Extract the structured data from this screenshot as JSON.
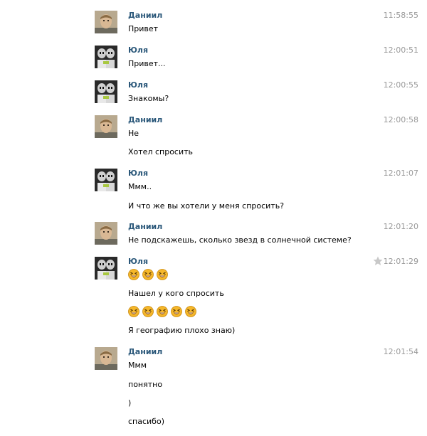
{
  "users": {
    "daniil": "Даниил",
    "yulia": "Юля"
  },
  "messages": [
    {
      "sender": "Даниил",
      "time": "11:58:55",
      "lines": [
        "Привет"
      ]
    },
    {
      "sender": "Юля",
      "time": "12:00:51",
      "lines": [
        "Привет..."
      ]
    },
    {
      "sender": "Юля",
      "time": "12:00:55",
      "lines": [
        "Знакомы?"
      ]
    },
    {
      "sender": "Даниил",
      "time": "12:00:58",
      "lines": [
        "Не",
        "Хотел спросить"
      ]
    },
    {
      "sender": "Юля",
      "time": "12:01:07",
      "lines": [
        "Ммм..",
        "И что же вы хотели у меня спросить?"
      ]
    },
    {
      "sender": "Даниил",
      "time": "12:01:20",
      "lines": [
        "Не подскажешь, сколько звезд в солнечной системе?"
      ]
    },
    {
      "sender": "Юля",
      "time": "12:01:29",
      "emoji_row_1": [
        "laughing-emoji",
        "laughing-emoji",
        "laughing-emoji"
      ],
      "lines": [
        "Нашел у кого спросить",
        "Я географию плохо знаю)"
      ],
      "emoji_row_2": [
        "laughing-emoji",
        "laughing-emoji",
        "laughing-emoji",
        "laughing-emoji",
        "laughing-emoji"
      ],
      "icon": "star-icon"
    },
    {
      "sender": "Даниил",
      "time": "12:01:54",
      "lines": [
        "Ммм",
        "понятно",
        ")",
        "спасибо)"
      ]
    }
  ],
  "colors": {
    "sender_name": "#2b587a",
    "timestamp": "#999999",
    "text": "#000000",
    "emoji": "#f5b72a"
  }
}
